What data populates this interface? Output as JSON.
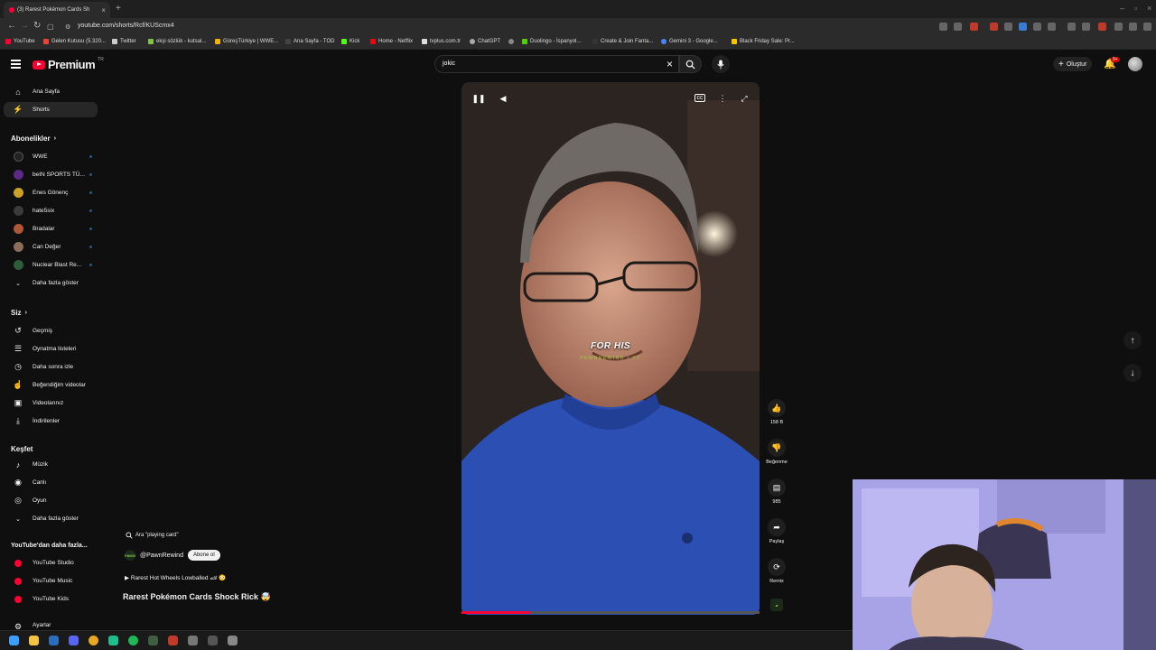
{
  "browser": {
    "tab_title": "(3) Rarest Pokémon Cards Sh",
    "url": "youtube.com/shorts/Rcf/KUScmx4",
    "bookmarks": [
      {
        "label": "YouTube",
        "color": "#ff0033"
      },
      {
        "label": "Gelen Kutusu (5.320...",
        "color": "#ea4335"
      },
      {
        "label": "Twitter",
        "color": "#cccccc"
      },
      {
        "label": "ekşi sözlük - kutsal...",
        "color": "#81c14b"
      },
      {
        "label": "GüreşTürkiye | WWE...",
        "color": "#f0b400"
      },
      {
        "label": "Ana Sayfa - TOD",
        "color": "#444444"
      },
      {
        "label": "Kick",
        "color": "#53fc18"
      },
      {
        "label": "Home - Netflix",
        "color": "#e50914"
      },
      {
        "label": "tvplus.com.tr",
        "color": "#dddddd"
      },
      {
        "label": "ChatGPT",
        "color": "#aaaaaa"
      },
      {
        "label": "",
        "color": "#888888"
      },
      {
        "label": "Duolingo - İspanyol...",
        "color": "#58cc02"
      },
      {
        "label": "Create & Join Fanta...",
        "color": "#333333"
      },
      {
        "label": "Gemini 3 - Google...",
        "color": "#4285f4"
      },
      {
        "label": "Black Friday Sale: Pr...",
        "color": "#f7c600"
      }
    ]
  },
  "header": {
    "logo_text": "Premium",
    "logo_region": "TR",
    "search_query": "jokic",
    "create_label": "Oluştur",
    "notification_count": "9+"
  },
  "sidebar": {
    "main": [
      {
        "label": "Ana Sayfa",
        "icon": "home-icon",
        "glyph": "⌂"
      },
      {
        "label": "Shorts",
        "icon": "shorts-icon",
        "glyph": "⚡"
      }
    ],
    "subscriptions_title": "Abonelikler",
    "subscriptions": [
      {
        "label": "WWE",
        "color": "#222222"
      },
      {
        "label": "beIN SPORTS TÜ...",
        "color": "#5b2a86"
      },
      {
        "label": "Enes Gönenç",
        "color": "#c9a227"
      },
      {
        "label": "hate5six",
        "color": "#3a3a3a"
      },
      {
        "label": "Bradalar",
        "color": "#b0573a"
      },
      {
        "label": "Can Değer",
        "color": "#8a6d5a"
      },
      {
        "label": "Nuclear Blast Re...",
        "color": "#2e5c3a"
      }
    ],
    "show_more": "Daha fazla göster",
    "you_title": "Siz",
    "you_items": [
      {
        "label": "Geçmiş",
        "icon": "history-icon",
        "glyph": "↺"
      },
      {
        "label": "Oynatma listeleri",
        "icon": "playlist-icon",
        "glyph": "☰"
      },
      {
        "label": "Daha sonra izle",
        "icon": "watch-later-icon",
        "glyph": "◷"
      },
      {
        "label": "Beğendiğim videolar",
        "icon": "liked-icon",
        "glyph": "👍"
      },
      {
        "label": "Videolarınız",
        "icon": "your-videos-icon",
        "glyph": "▣"
      },
      {
        "label": "İndirilenler",
        "icon": "downloads-icon",
        "glyph": "⤓"
      }
    ],
    "explore_title": "Keşfet",
    "explore_items": [
      {
        "label": "Müzik",
        "icon": "music-icon",
        "glyph": "♪"
      },
      {
        "label": "Canlı",
        "icon": "live-icon",
        "glyph": "◉"
      },
      {
        "label": "Oyun",
        "icon": "gaming-icon",
        "glyph": "🎮"
      }
    ],
    "explore_more": "Daha fazla göster",
    "more_title": "YouTube'dan daha fazla...",
    "more_items": [
      {
        "label": "YouTube Studio",
        "icon": "yt-studio-icon"
      },
      {
        "label": "YouTube Music",
        "icon": "yt-music-icon"
      },
      {
        "label": "YouTube Kids",
        "icon": "yt-kids-icon"
      }
    ],
    "settings_label": "Ayarlar"
  },
  "video": {
    "caption": "FOR HIS",
    "watermark": "PAWNREWIND | YT",
    "progress": 0.23,
    "search_chip": "Ara \"playing card\"",
    "channel": "@PawnRewind",
    "channel_badge": "PAWN",
    "subscribe_label": "Abone ol",
    "related": "Rarest Hot Wheels Lowballed 🏎 😳",
    "title": "Rarest Pokémon Cards Shock Rick 🤯"
  },
  "actions": {
    "like_count": "158 B",
    "dislike_label": "Beğenme",
    "comment_count": "985",
    "share_label": "Paylaş",
    "remix_label": "Remix"
  }
}
